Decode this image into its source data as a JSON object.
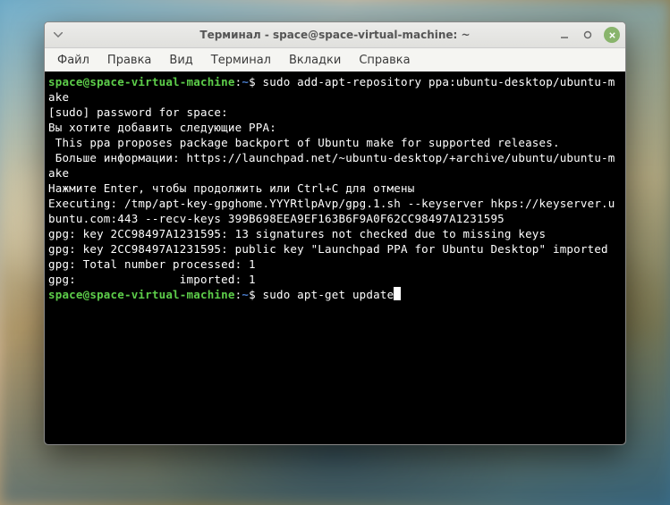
{
  "titlebar": {
    "title": "Терминал - space@space-virtual-machine: ~"
  },
  "menubar": {
    "items": [
      "Файл",
      "Правка",
      "Вид",
      "Терминал",
      "Вкладки",
      "Справка"
    ]
  },
  "terminal": {
    "prompt_user": "space@space-virtual-machine",
    "prompt_sep": ":",
    "prompt_path": "~",
    "prompt_symbol": "$",
    "line1_cmd": " sudo add-apt-repository ppa:ubuntu-desktop/ubuntu-make",
    "line2": "[sudo] password for space: ",
    "line3": "Вы хотите добавить следующие PPA:",
    "line4": " This ppa proposes package backport of Ubuntu make for supported releases.",
    "line5": " Больше информации: https://launchpad.net/~ubuntu-desktop/+archive/ubuntu/ubuntu-make",
    "line6": "Нажмите Enter, чтобы продолжить или Ctrl+C для отмены",
    "line7": "",
    "line8": "Executing: /tmp/apt-key-gpghome.YYYRtlpAvp/gpg.1.sh --keyserver hkps://keyserver.ubuntu.com:443 --recv-keys 399B698EEA9EF163B6F9A0F62CC98497A1231595",
    "line9": "gpg: key 2CC98497A1231595: 13 signatures not checked due to missing keys",
    "line10": "gpg: key 2CC98497A1231595: public key \"Launchpad PPA for Ubuntu Desktop\" imported",
    "line11": "gpg: Total number processed: 1",
    "line12": "gpg:               imported: 1",
    "line13_cmd": " sudo apt-get update"
  }
}
